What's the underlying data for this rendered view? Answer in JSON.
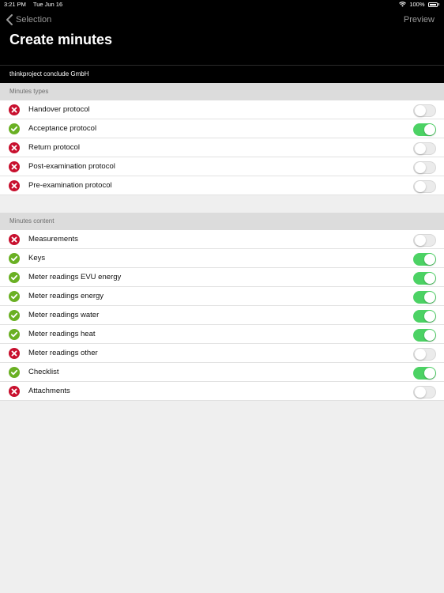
{
  "status_bar": {
    "time": "3:21 PM",
    "date": "Tue Jun 16",
    "battery": "100%"
  },
  "nav": {
    "back_label": "Selection",
    "preview_label": "Preview"
  },
  "page_title": "Create minutes",
  "company": "thinkproject conclude GmbH",
  "colors": {
    "toggle_on": "#4cd264",
    "check_green": "#6ab023",
    "cross_red": "#c8102e"
  },
  "sections": [
    {
      "header": "Minutes types",
      "items": [
        {
          "label": "Handover protocol",
          "enabled": false,
          "icon": "cross-icon"
        },
        {
          "label": "Acceptance protocol",
          "enabled": true,
          "icon": "check-icon"
        },
        {
          "label": "Return protocol",
          "enabled": false,
          "icon": "cross-icon"
        },
        {
          "label": "Post-examination protocol",
          "enabled": false,
          "icon": "cross-icon"
        },
        {
          "label": "Pre-examination protocol",
          "enabled": false,
          "icon": "cross-icon"
        }
      ]
    },
    {
      "header": "Minutes content",
      "items": [
        {
          "label": "Measurements",
          "enabled": false,
          "icon": "cross-icon"
        },
        {
          "label": "Keys",
          "enabled": true,
          "icon": "check-icon"
        },
        {
          "label": "Meter readings EVU energy",
          "enabled": true,
          "icon": "check-icon"
        },
        {
          "label": "Meter readings energy",
          "enabled": true,
          "icon": "check-icon"
        },
        {
          "label": "Meter readings water",
          "enabled": true,
          "icon": "check-icon"
        },
        {
          "label": "Meter readings heat",
          "enabled": true,
          "icon": "check-icon"
        },
        {
          "label": "Meter readings other",
          "enabled": false,
          "icon": "cross-icon"
        },
        {
          "label": "Checklist",
          "enabled": true,
          "icon": "check-icon"
        },
        {
          "label": "Attachments",
          "enabled": false,
          "icon": "cross-icon"
        }
      ]
    }
  ]
}
